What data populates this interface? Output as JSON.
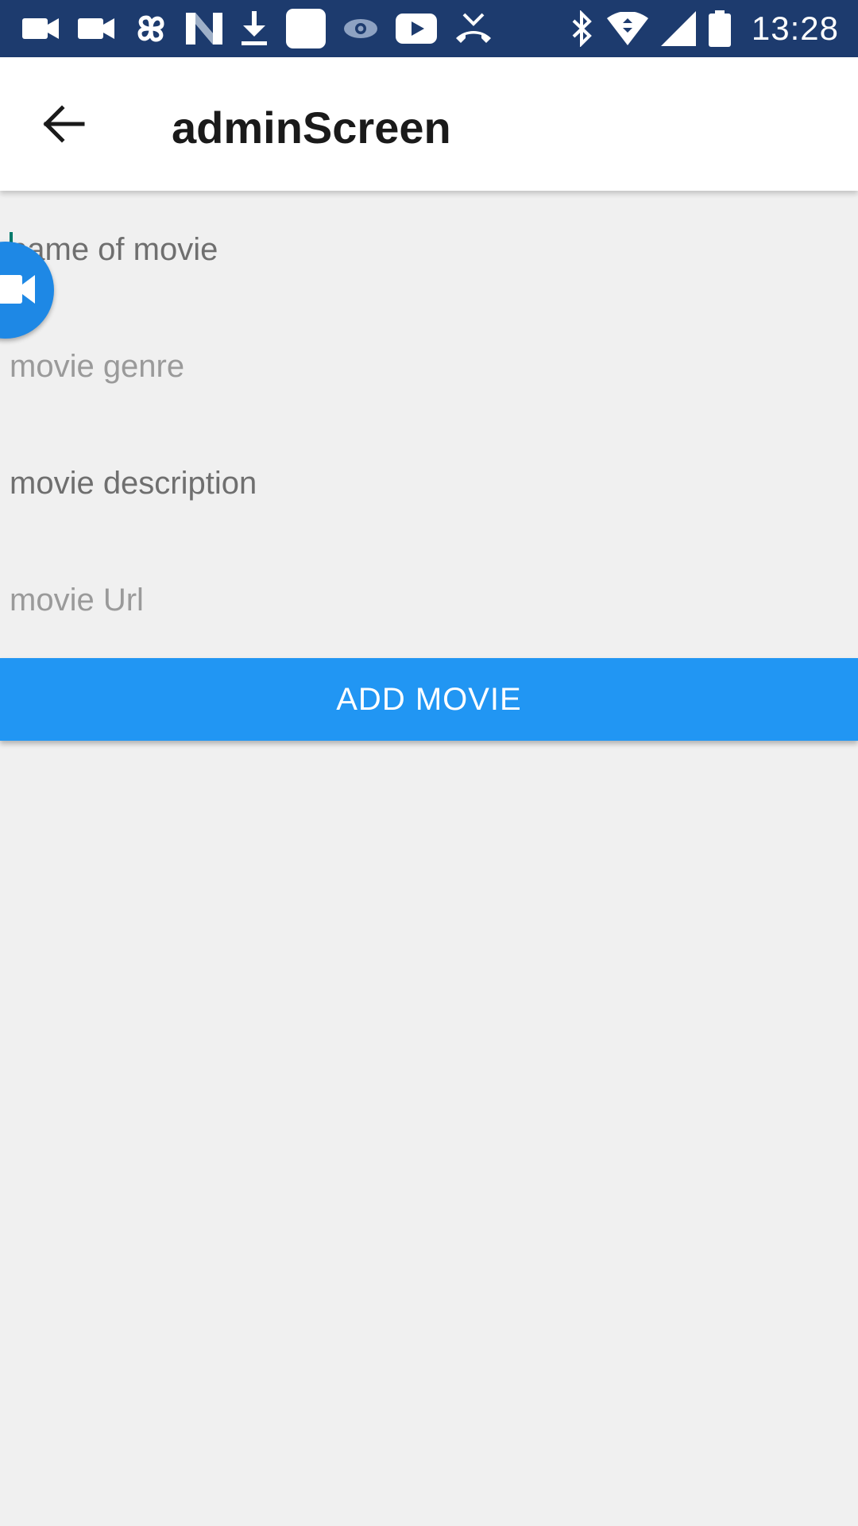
{
  "status_bar": {
    "time": "13:28",
    "left_icons": [
      "video-camera-icon",
      "video-camera-icon",
      "pinwheel-icon",
      "n-logo-icon",
      "download-icon",
      "white-square-icon",
      "eye-icon",
      "youtube-icon",
      "missed-call-icon"
    ],
    "right_icons": [
      "bluetooth-icon",
      "wifi-icon",
      "cell-signal-icon",
      "battery-icon"
    ],
    "background": "#1d3b6e"
  },
  "app_bar": {
    "title": "adminScreen",
    "back_icon": "arrow-back-icon"
  },
  "form": {
    "name_placeholder": "name of movie",
    "genre_placeholder": "movie genre",
    "description_placeholder": "movie description",
    "url_placeholder": "movie Url",
    "name_value": "",
    "genre_value": "",
    "description_value": "",
    "url_value": ""
  },
  "actions": {
    "add_movie_label": "ADD MOVIE",
    "button_color": "#2196f3"
  },
  "overlay": {
    "bubble_icon": "video-camera-icon",
    "bubble_color": "#1e88e5"
  },
  "colors": {
    "background": "#f0f0f0",
    "cursor": "#00796b"
  }
}
